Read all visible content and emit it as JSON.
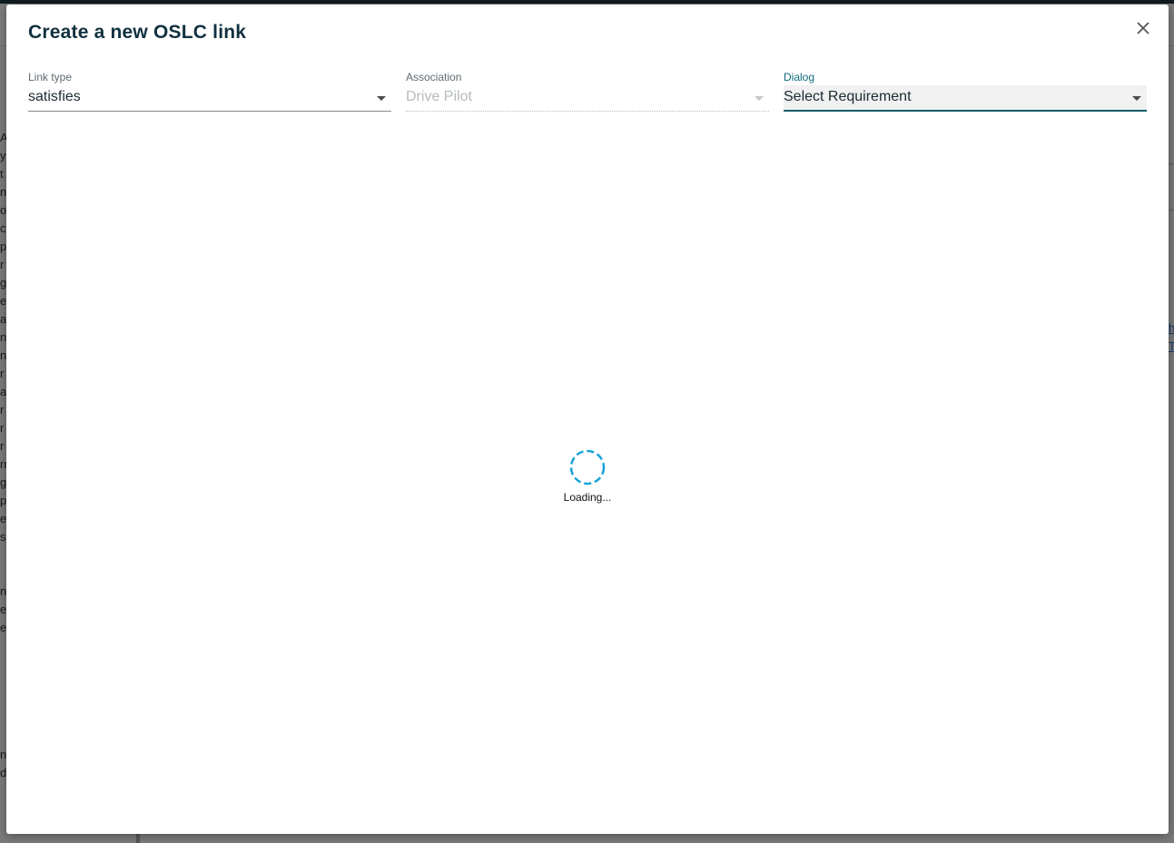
{
  "background": {
    "left_text_fragments": [
      "A",
      "ys",
      "t",
      "n",
      "o",
      "c",
      "p",
      "r",
      "g",
      "e",
      "ac",
      "n",
      "ns",
      "r",
      "a",
      "r",
      "r",
      "r",
      "rr",
      "g",
      "p",
      "e",
      "s",
      "",
      "",
      "ni",
      "ec",
      "er"
    ],
    "left_text_bottom": [
      "nt",
      "di"
    ],
    "right_links": [
      "ha",
      "T"
    ]
  },
  "modal": {
    "title": "Create a new OSLC link",
    "close_label": "×",
    "fields": {
      "link_type": {
        "label": "Link type",
        "value": "satisfies"
      },
      "association": {
        "label": "Association",
        "value": "Drive Pilot"
      },
      "dialog": {
        "label": "Dialog",
        "value": "Select Requirement"
      }
    },
    "loading_text": "Loading..."
  },
  "colors": {
    "title": "#11313f",
    "active_accent": "#0e5b6b",
    "spinner": "#1aa3d9"
  },
  "icons": {
    "close": "close-icon",
    "dropdown": "chevron-down-icon",
    "spinner": "loading-spinner-icon"
  }
}
